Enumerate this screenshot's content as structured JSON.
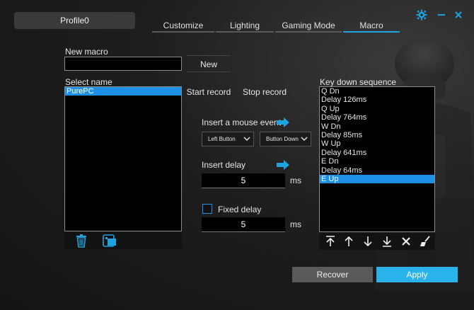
{
  "colors": {
    "accent": "#1ea3dd",
    "selection": "#1e90e6",
    "apply": "#2ab3ea",
    "recover": "#5a5a5a"
  },
  "header": {
    "profile": "Profile0",
    "tabs": [
      {
        "label": "Customize",
        "active": false
      },
      {
        "label": "Lighting",
        "active": false
      },
      {
        "label": "Gaming Mode",
        "active": false
      },
      {
        "label": "Macro",
        "active": true
      }
    ],
    "icons": [
      "gear-icon",
      "minimize-icon",
      "close-icon"
    ]
  },
  "new_macro": {
    "label": "New macro",
    "value": "",
    "button": "New"
  },
  "select_name": {
    "label": "Select name",
    "items": [
      {
        "label": "PurePC",
        "selected": true
      }
    ],
    "icons": [
      "trash-icon",
      "import-icon"
    ]
  },
  "record": {
    "start": "Start record",
    "stop": "Stop record"
  },
  "mouse_event": {
    "label": "Insert a mouse event",
    "button_select": "Left Button",
    "action_select": "Button Down"
  },
  "delay": {
    "label": "Insert delay",
    "value": "5",
    "unit": "ms"
  },
  "fixed_delay": {
    "label": "Fixed delay",
    "checked": false,
    "value": "5",
    "unit": "ms"
  },
  "sequence": {
    "label": "Key down sequence",
    "items": [
      {
        "label": "Q Dn",
        "selected": false
      },
      {
        "label": "Delay 126ms",
        "selected": false
      },
      {
        "label": "Q Up",
        "selected": false
      },
      {
        "label": "Delay 764ms",
        "selected": false
      },
      {
        "label": "W Dn",
        "selected": false
      },
      {
        "label": "Delay 85ms",
        "selected": false
      },
      {
        "label": "W Up",
        "selected": false
      },
      {
        "label": "Delay 641ms",
        "selected": false
      },
      {
        "label": "E Dn",
        "selected": false
      },
      {
        "label": "Delay 64ms",
        "selected": false
      },
      {
        "label": "E Up",
        "selected": true
      }
    ],
    "tools": [
      "move-top-icon",
      "move-up-icon",
      "move-down-icon",
      "move-bottom-icon",
      "delete-icon",
      "clear-icon"
    ]
  },
  "footer": {
    "recover": "Recover",
    "apply": "Apply"
  }
}
